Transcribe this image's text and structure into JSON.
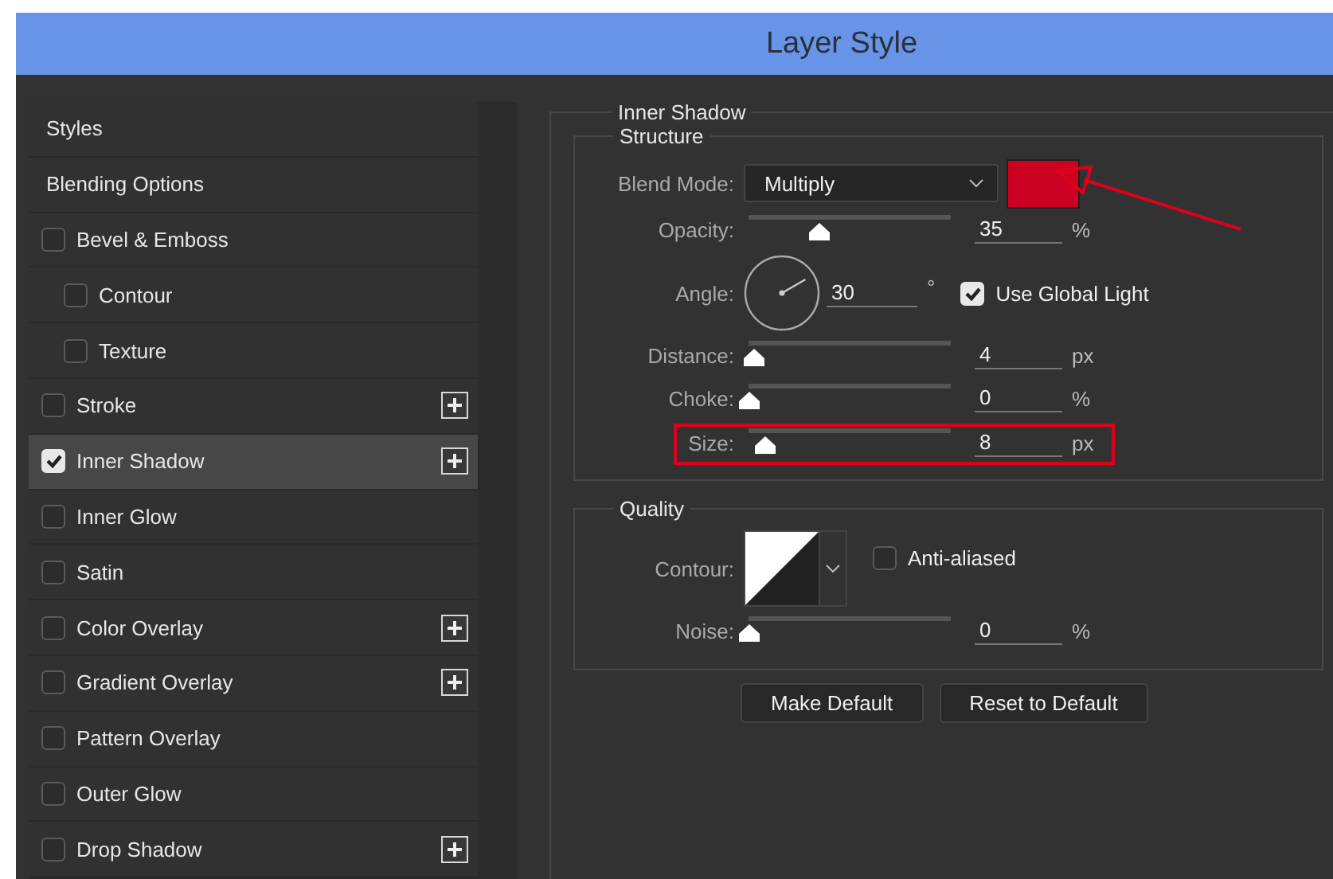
{
  "window": {
    "title": "Layer Style"
  },
  "sidebar": {
    "items": [
      {
        "label": "Styles",
        "kind": "header",
        "selected": false
      },
      {
        "label": "Blending Options",
        "kind": "header",
        "selected": false
      },
      {
        "label": "Bevel & Emboss",
        "kind": "effect",
        "checked": false,
        "selected": false,
        "add": false,
        "children": [
          {
            "label": "Contour",
            "kind": "effect",
            "checked": false,
            "selected": false,
            "add": false
          },
          {
            "label": "Texture",
            "kind": "effect",
            "checked": false,
            "selected": false,
            "add": false
          }
        ]
      },
      {
        "label": "Stroke",
        "kind": "effect",
        "checked": false,
        "selected": false,
        "add": true
      },
      {
        "label": "Inner Shadow",
        "kind": "effect",
        "checked": true,
        "selected": true,
        "add": true
      },
      {
        "label": "Inner Glow",
        "kind": "effect",
        "checked": false,
        "selected": false,
        "add": false
      },
      {
        "label": "Satin",
        "kind": "effect",
        "checked": false,
        "selected": false,
        "add": false
      },
      {
        "label": "Color Overlay",
        "kind": "effect",
        "checked": false,
        "selected": false,
        "add": true
      },
      {
        "label": "Gradient Overlay",
        "kind": "effect",
        "checked": false,
        "selected": false,
        "add": true
      },
      {
        "label": "Pattern Overlay",
        "kind": "effect",
        "checked": false,
        "selected": false,
        "add": false
      },
      {
        "label": "Outer Glow",
        "kind": "effect",
        "checked": false,
        "selected": false,
        "add": false
      },
      {
        "label": "Drop Shadow",
        "kind": "effect",
        "checked": false,
        "selected": false,
        "add": true
      }
    ]
  },
  "panel": {
    "title": "Inner Shadow",
    "sections": [
      {
        "title": "Structure",
        "rows": [
          {
            "kind": "dropdown",
            "label": "Blend Mode:",
            "value": "Multiply",
            "color": "#cc0020",
            "pointed": true
          },
          {
            "kind": "slider",
            "label": "Opacity:",
            "level": 0.35,
            "value": "35",
            "unit": "%",
            "highlighted": false
          },
          {
            "kind": "angle",
            "label": "Angle:",
            "value": "30",
            "unit": "°",
            "option": {
              "label": "Use Global Light",
              "checked": true
            }
          },
          {
            "kind": "slider",
            "label": "Distance:",
            "level": 0.03,
            "value": "4",
            "unit": "px",
            "highlighted": false
          },
          {
            "kind": "slider",
            "label": "Choke:",
            "level": 0,
            "value": "0",
            "unit": "%",
            "highlighted": false
          },
          {
            "kind": "slider",
            "label": "Size:",
            "level": 0.08,
            "value": "8",
            "unit": "px",
            "highlighted": true
          }
        ]
      },
      {
        "title": "Quality",
        "rows": [
          {
            "kind": "contour",
            "label": "Contour:",
            "option": {
              "label": "Anti-aliased",
              "checked": false
            }
          },
          {
            "kind": "slider",
            "label": "Noise:",
            "level": 0,
            "value": "0",
            "unit": "%",
            "highlighted": false
          }
        ]
      }
    ]
  },
  "buttons": [
    "Make Default",
    "Reset to Default"
  ]
}
